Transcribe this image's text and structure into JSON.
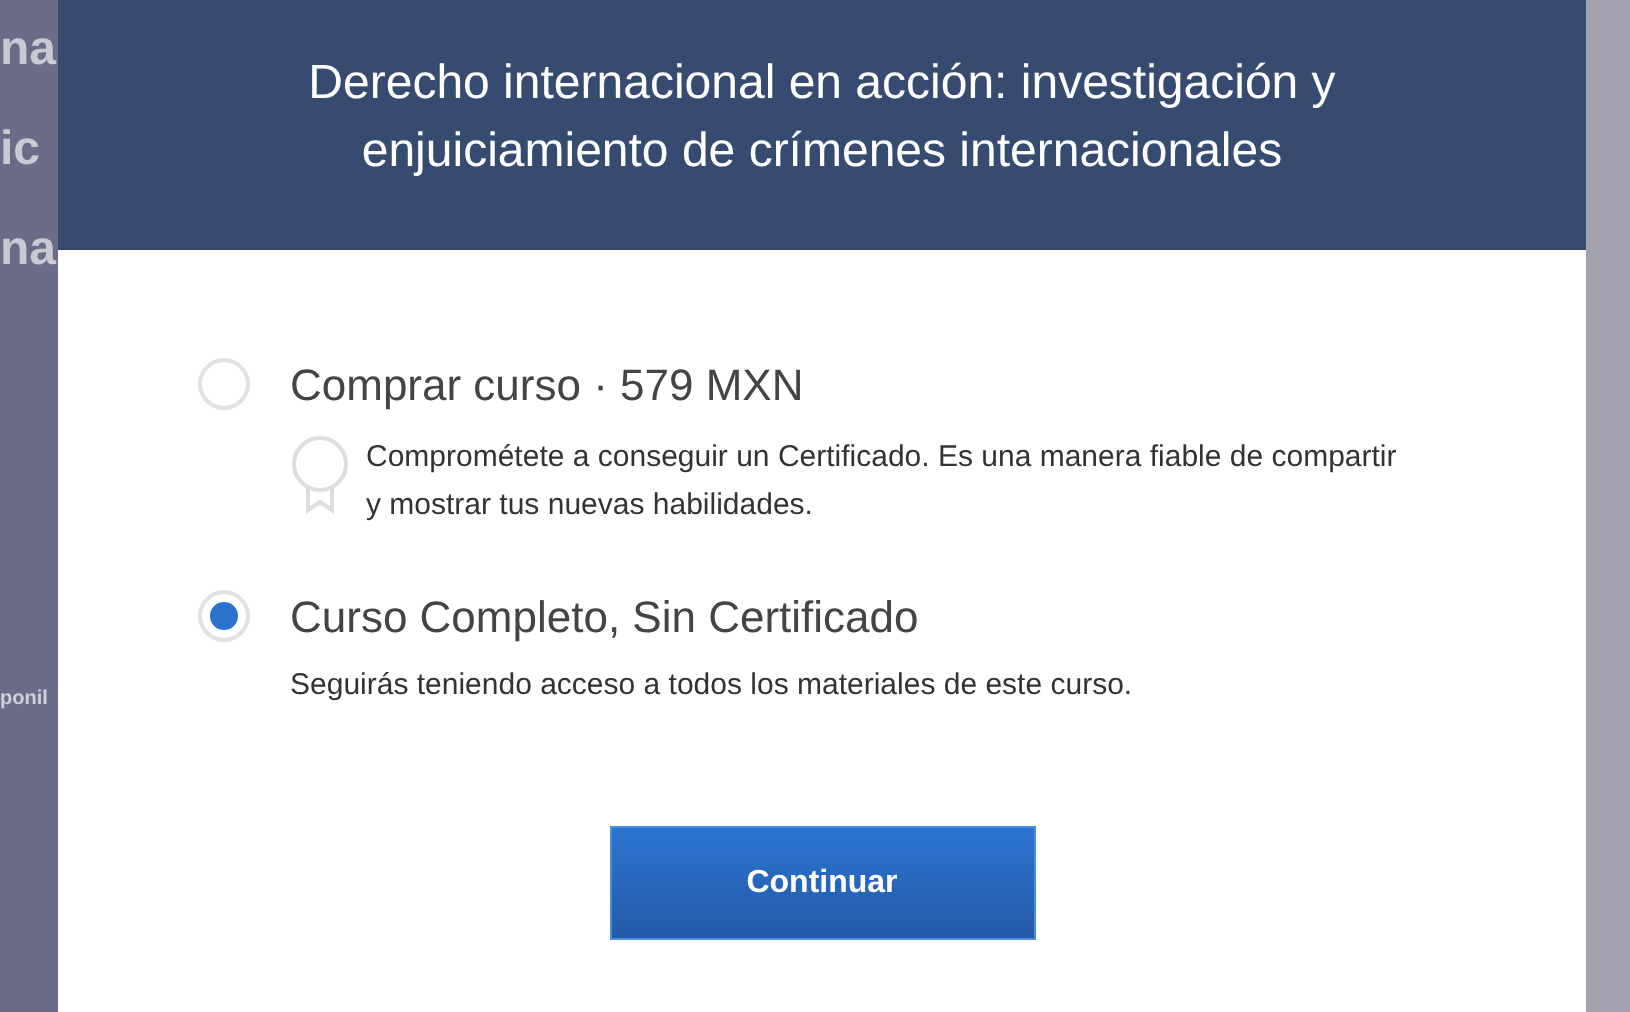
{
  "background": {
    "heading_lines": [
      "na",
      "ic",
      "na"
    ],
    "note": "ponil"
  },
  "dialog": {
    "title": "Derecho internacional en acción: investigación y enjuiciamiento de crímenes internacionales",
    "options": [
      {
        "kind": "badge",
        "label": "Comprar curso · 579 MXN",
        "description": "Comprométete a conseguir un Certificado. Es una manera fiable de compartir y mostrar tus nuevas habilidades.",
        "selected": false
      },
      {
        "kind": "plain",
        "label": "Curso Completo, Sin Certificado",
        "description": "Seguirás teniendo acceso a todos los materiales de este curso.",
        "selected": true
      }
    ],
    "button": "Continuar"
  }
}
